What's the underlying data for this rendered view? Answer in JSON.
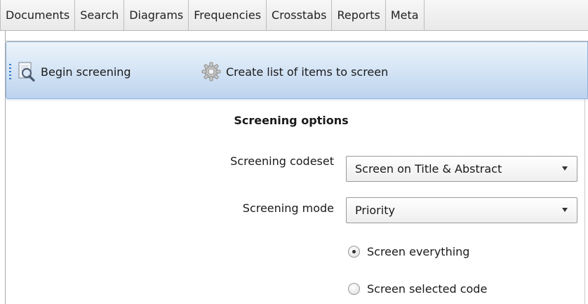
{
  "tabs": [
    {
      "label": "Documents"
    },
    {
      "label": "Search"
    },
    {
      "label": "Diagrams"
    },
    {
      "label": "Frequencies"
    },
    {
      "label": "Crosstabs"
    },
    {
      "label": "Reports"
    },
    {
      "label": "Meta"
    }
  ],
  "toolbar": {
    "begin_screening": {
      "label": "Begin screening",
      "icon": "magnifier-document-icon"
    },
    "create_list": {
      "label": "Create list of items to screen",
      "icon": "gear-icon"
    }
  },
  "options": {
    "title": "Screening options",
    "codeset": {
      "label": "Screening codeset",
      "value": "Screen on Title & Abstract"
    },
    "mode": {
      "label": "Screening mode",
      "value": "Priority"
    },
    "radios": [
      {
        "label": "Screen everything",
        "checked": true
      },
      {
        "label": "Screen selected code",
        "checked": false
      }
    ]
  },
  "colors": {
    "toolbar_gradient_top": "#ecf3fb",
    "toolbar_gradient_bottom": "#bcd3ee",
    "toolbar_border": "#8fb1d8",
    "grip": "#3d7dc2"
  }
}
